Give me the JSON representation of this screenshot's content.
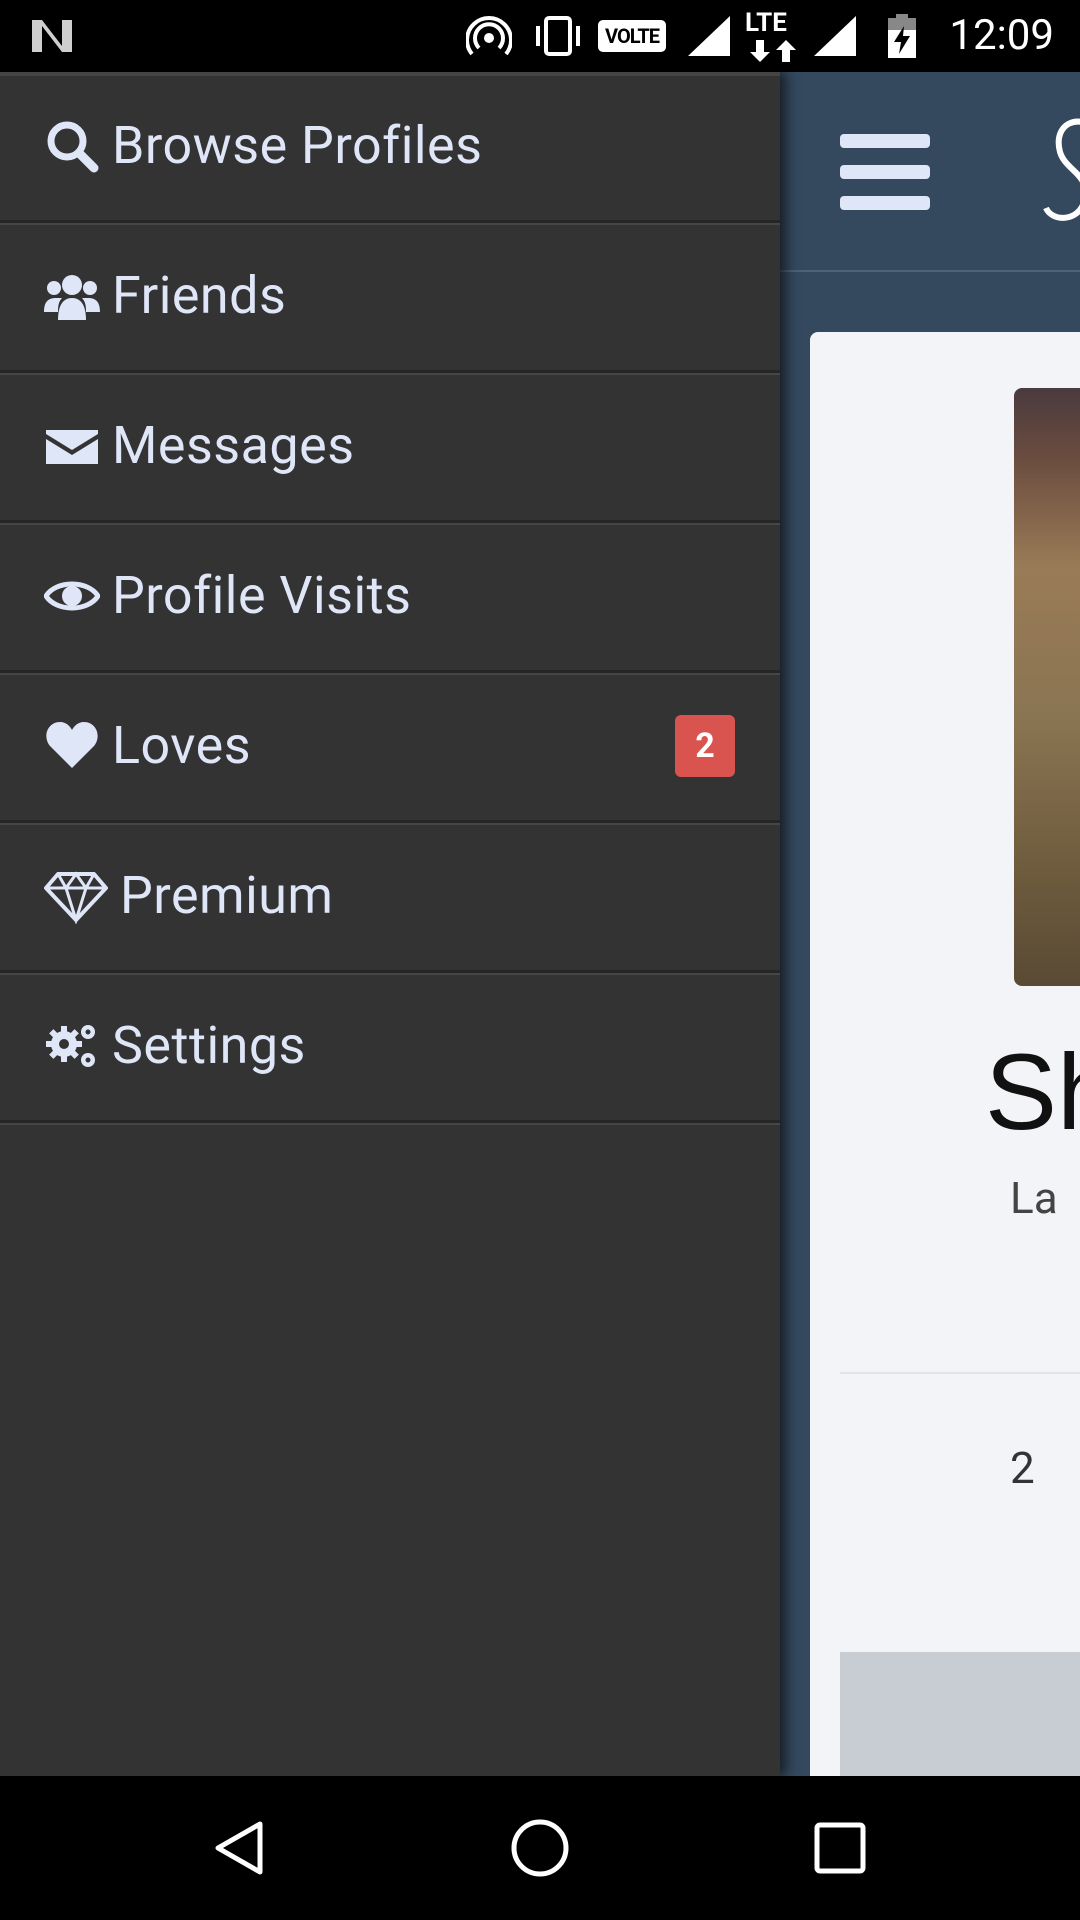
{
  "status_bar": {
    "time": "12:09",
    "network_badge": "VOLTE",
    "network_type": "LTE",
    "icons": [
      "n-logo-icon",
      "hotspot-icon",
      "vibrate-icon",
      "signal-icon",
      "signal-icon",
      "battery-charging-icon"
    ]
  },
  "drawer": {
    "items": [
      {
        "label": "Browse Profiles",
        "icon": "search-icon"
      },
      {
        "label": "Friends",
        "icon": "users-icon"
      },
      {
        "label": "Messages",
        "icon": "envelope-icon"
      },
      {
        "label": "Profile Visits",
        "icon": "eye-icon"
      },
      {
        "label": "Loves",
        "icon": "heart-icon",
        "badge": "2"
      },
      {
        "label": "Premium",
        "icon": "diamond-icon"
      },
      {
        "label": "Settings",
        "icon": "gears-icon"
      }
    ],
    "badge_color": "#d9534f",
    "text_color": "#dfe6f7",
    "background": "#333333"
  },
  "main": {
    "header_bg": "#34495e",
    "profile_name_partial": "Sh",
    "profile_sub_partial": "La",
    "profile_num_partial": "2"
  },
  "nav_bar": {
    "icons": [
      "back-icon",
      "home-icon",
      "recents-icon"
    ]
  }
}
